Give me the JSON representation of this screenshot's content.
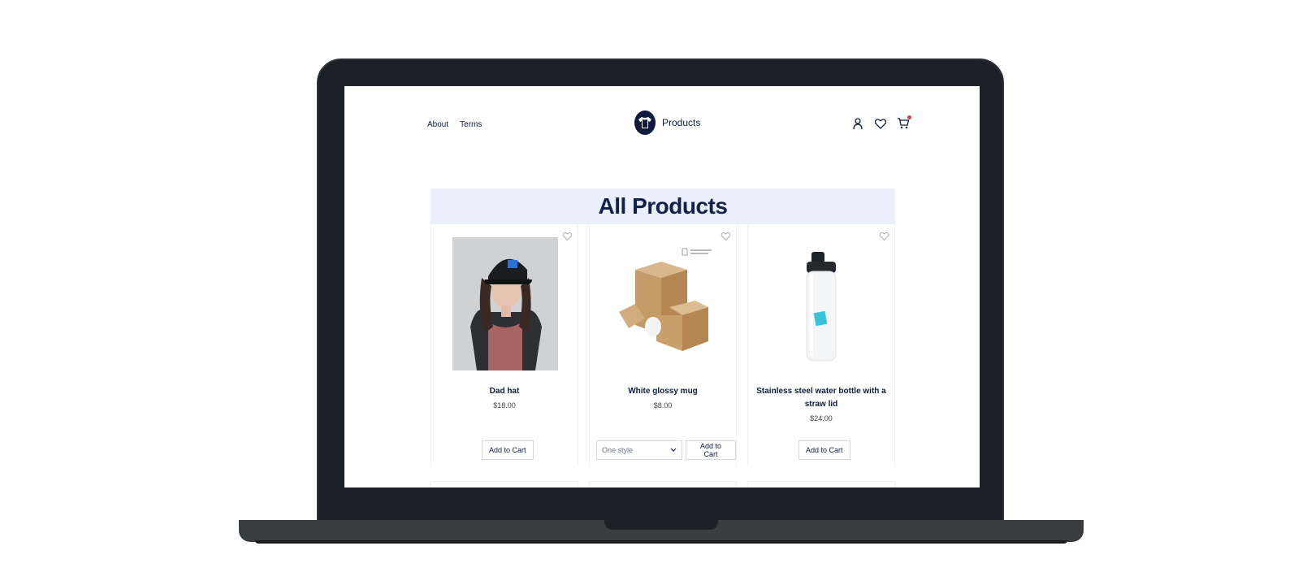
{
  "nav": {
    "links": [
      "About",
      "Terms"
    ],
    "brand": "Products",
    "icons": [
      "user-icon",
      "heart-icon",
      "cart-icon"
    ]
  },
  "banner": {
    "title": "All Products"
  },
  "products": [
    {
      "name": "Dad hat",
      "price": "$18.00",
      "button": "Add to Cart"
    },
    {
      "name": "White glossy mug",
      "price": "$8.00",
      "button": "Add to Cart",
      "select": "One style"
    },
    {
      "name": "Stainless steel water bottle with a straw lid",
      "price": "$24.00",
      "button": "Add to Cart"
    }
  ],
  "colors": {
    "navy": "#0f1b3d",
    "banner_bg": "#e9f0fb",
    "laptop": "#1d2125",
    "cart_badge": "#e23b3b"
  }
}
